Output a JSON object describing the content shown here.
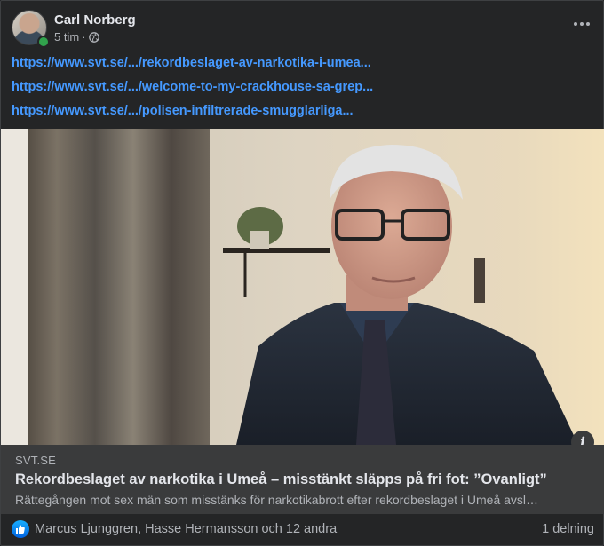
{
  "post": {
    "author": "Carl Norberg",
    "time": "5 tim",
    "separator": "·",
    "links": [
      "https://www.svt.se/.../rekordbeslaget-av-narkotika-i-umea...",
      "https://www.svt.se/.../welcome-to-my-crackhouse-sa-grep...",
      "https://www.svt.se/.../polisen-infiltrerade-smugglarliga..."
    ]
  },
  "preview": {
    "source": "SVT.SE",
    "title": "Rekordbeslaget av narkotika i Umeå – misstänkt släpps på fri fot: ”Ovanligt”",
    "description": "Rättegången mot sex män som misstänks för narkotikabrott efter rekordbeslaget i Umeå avsl…",
    "info_glyph": "i"
  },
  "footer": {
    "reactors": "Marcus Ljunggren, Hasse Hermansson och 12 andra",
    "shares": "1 delning"
  },
  "icons": {
    "more": "more-horizontal-icon",
    "privacy": "globe-icon",
    "like": "like-icon",
    "info": "info-icon"
  },
  "colors": {
    "card_bg": "#242526",
    "link": "#4599ff",
    "preview_bg": "#3a3b3c",
    "online": "#31a24c",
    "like": "#0a7cff"
  }
}
